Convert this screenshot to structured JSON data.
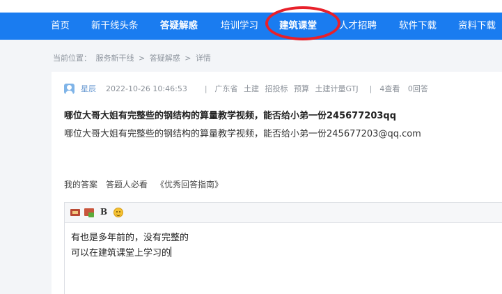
{
  "nav": {
    "items": [
      {
        "label": "首页",
        "bold": false
      },
      {
        "label": "新干线头条",
        "bold": false
      },
      {
        "label": "答疑解惑",
        "bold": true
      },
      {
        "label": "培训学习",
        "bold": false
      },
      {
        "label": "建筑课堂",
        "bold": true
      },
      {
        "label": "人才招聘",
        "bold": false
      },
      {
        "label": "软件下载",
        "bold": false
      },
      {
        "label": "资料下载",
        "bold": false
      }
    ],
    "highlight_color": "#e8202a",
    "bg_color": "#1a7cf0"
  },
  "breadcrumb": {
    "prefix": "当前位置：",
    "items": [
      "服务新干线",
      ">",
      "答疑解惑",
      ">",
      "详情"
    ]
  },
  "question": {
    "author": "星辰",
    "time": "2022-10-26 10:46:53",
    "separator": "|",
    "region": "广东省",
    "tags": [
      "土建",
      "招投标",
      "预算",
      "土建计量GTJ"
    ],
    "views": "4查看",
    "answers": "0回答",
    "title": "哪位大哥大姐有完整些的钢结构的算量教学视频，能否给小弟一份245677203qq",
    "body": "哪位大哥大姐有完整些的钢结构的算量教学视频，能否给小弟一份245677203@qq.com"
  },
  "answer_tabs": {
    "my_answer": "我的答案",
    "must_read": "答题人必看",
    "guide": "《优秀回答指南》"
  },
  "editor": {
    "bold_label": "B",
    "lines": [
      "有也是多年前的，没有完整的",
      "可以在建筑课堂上学习的"
    ]
  }
}
